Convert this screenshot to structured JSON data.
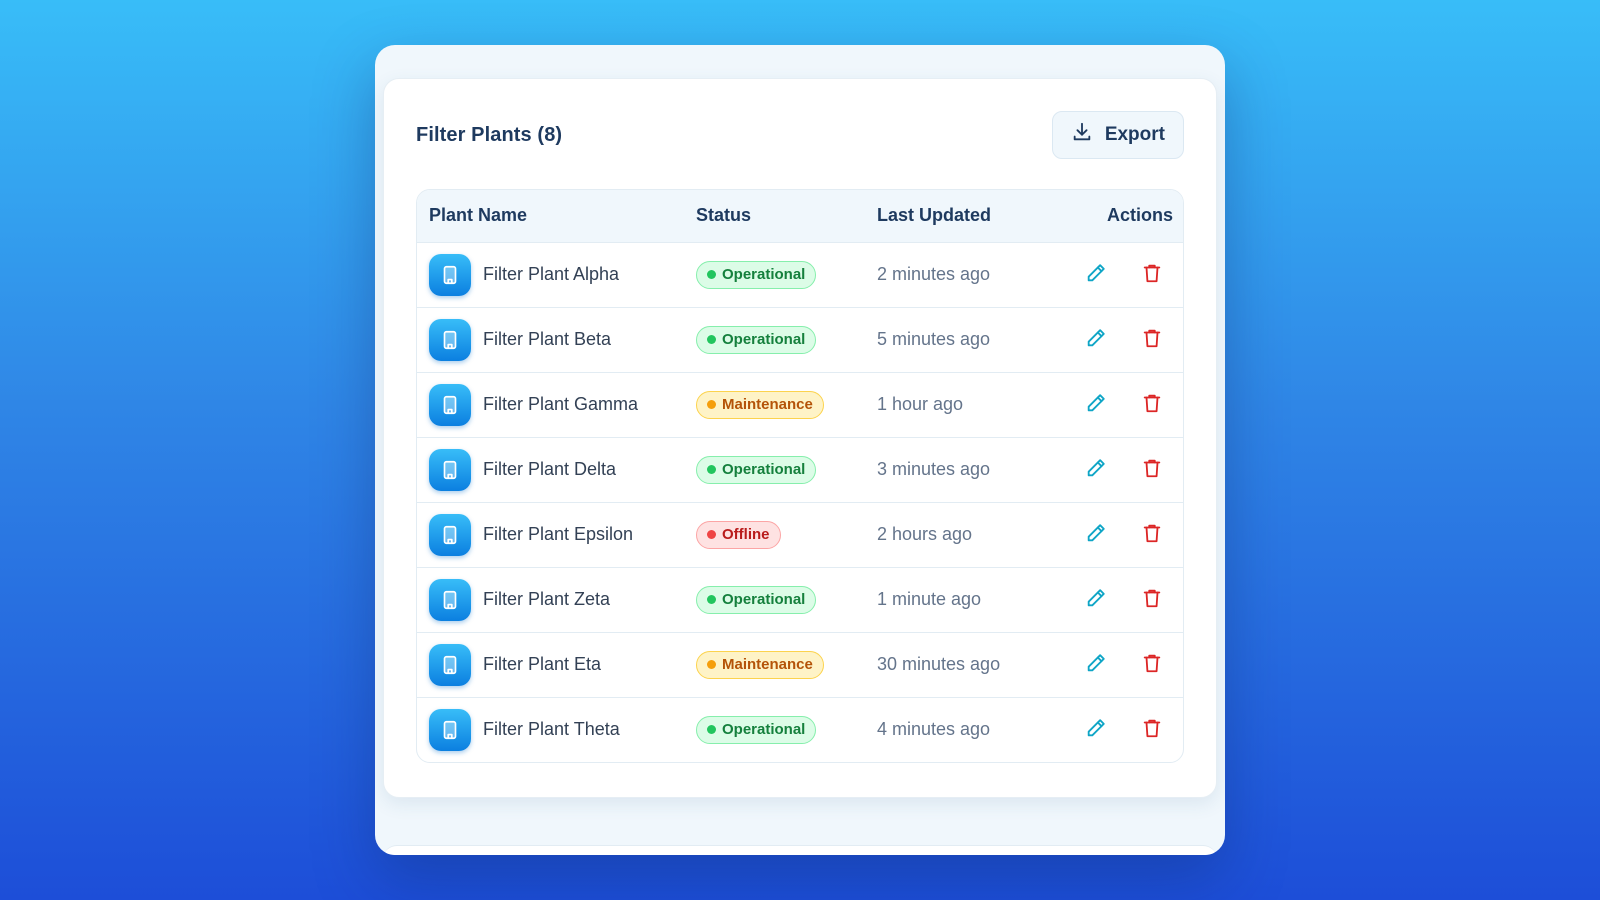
{
  "card": {
    "title": "Filter Plants (8)",
    "export_label": "Export"
  },
  "table": {
    "headers": {
      "name": "Plant Name",
      "status": "Status",
      "updated": "Last Updated",
      "actions": "Actions"
    },
    "rows": [
      {
        "name": "Filter Plant Alpha",
        "status": "Operational",
        "status_kind": "operational",
        "updated": "2 minutes ago"
      },
      {
        "name": "Filter Plant Beta",
        "status": "Operational",
        "status_kind": "operational",
        "updated": "5 minutes ago"
      },
      {
        "name": "Filter Plant Gamma",
        "status": "Maintenance",
        "status_kind": "maintenance",
        "updated": "1 hour ago"
      },
      {
        "name": "Filter Plant Delta",
        "status": "Operational",
        "status_kind": "operational",
        "updated": "3 minutes ago"
      },
      {
        "name": "Filter Plant Epsilon",
        "status": "Offline",
        "status_kind": "offline",
        "updated": "2 hours ago"
      },
      {
        "name": "Filter Plant Zeta",
        "status": "Operational",
        "status_kind": "operational",
        "updated": "1 minute ago"
      },
      {
        "name": "Filter Plant Eta",
        "status": "Maintenance",
        "status_kind": "maintenance",
        "updated": "30 minutes ago"
      },
      {
        "name": "Filter Plant Theta",
        "status": "Operational",
        "status_kind": "operational",
        "updated": "4 minutes ago"
      }
    ]
  },
  "icons": {
    "export": "download-icon",
    "plant": "building-icon",
    "edit": "pencil-icon",
    "delete": "trash-icon"
  },
  "colors": {
    "background_top": "#38bdf8",
    "background_bottom": "#1d4ed8",
    "title_text": "#1e3a5f",
    "edit_icon": "#0ea5c6",
    "delete_icon": "#dc2626",
    "operational": "#22c55e",
    "maintenance": "#f59e0b",
    "offline": "#ef4444"
  }
}
